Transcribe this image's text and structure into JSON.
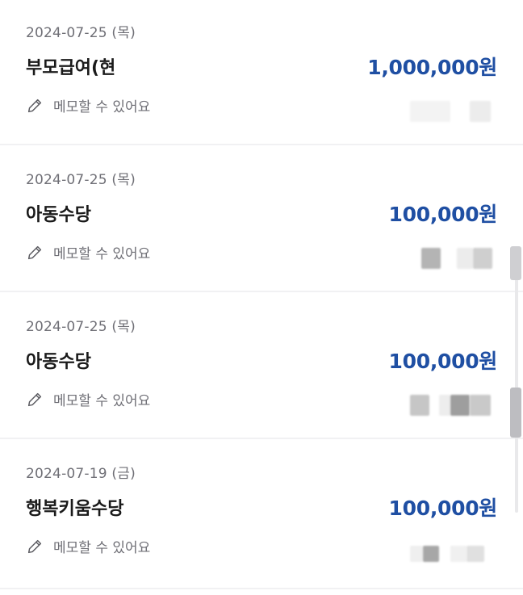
{
  "items": [
    {
      "date": "2024-07-25 (목)",
      "title": "부모급여(현",
      "amount": "1,000,000원",
      "memo": "메모할 수 있어요"
    },
    {
      "date": "2024-07-25 (목)",
      "title": "아동수당",
      "amount": "100,000원",
      "memo": "메모할 수 있어요"
    },
    {
      "date": "2024-07-25 (목)",
      "title": "아동수당",
      "amount": "100,000원",
      "memo": "메모할 수 있어요"
    },
    {
      "date": "2024-07-19 (금)",
      "title": "행복키움수당",
      "amount": "100,000원",
      "memo": "메모할 수 있어요"
    }
  ],
  "icons": {
    "memo": "pencil-icon"
  },
  "colors": {
    "amount": "#1f4fa3",
    "secondary_text": "#6f6f76",
    "divider": "#f1f1f3"
  }
}
